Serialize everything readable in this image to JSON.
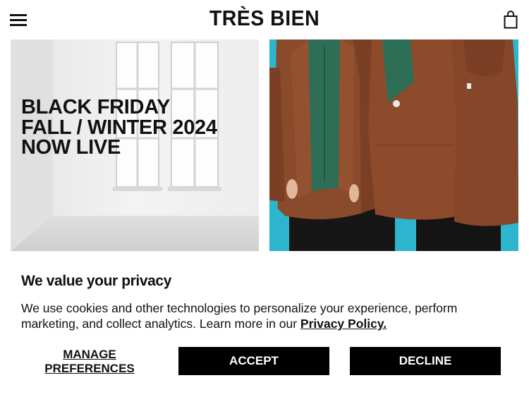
{
  "header": {
    "logo": "TRÈS BIEN"
  },
  "hero": {
    "line1": "BLACK FRIDAY",
    "line2": "FALL / WINTER 2024",
    "line3": "NOW LIVE"
  },
  "cookie": {
    "title": "We value your privacy",
    "body": "We use cookies and other technologies to personalize your experience, perform marketing, and collect analytics. Learn more in our ",
    "link": "Privacy Policy.",
    "manage": "MANAGE PREFERENCES",
    "accept": "ACCEPT",
    "decline": "DECLINE"
  }
}
